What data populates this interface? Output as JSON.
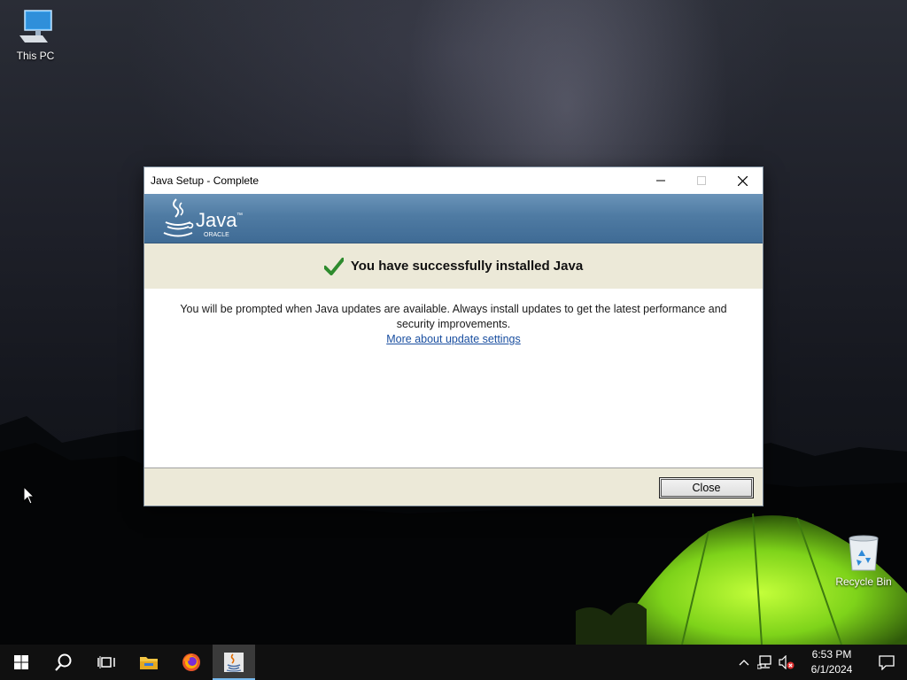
{
  "desktop": {
    "icons": [
      {
        "label": "This PC",
        "icon": "this-pc-icon"
      },
      {
        "label": "Recycle Bin",
        "icon": "recycle-bin-icon"
      }
    ]
  },
  "dialog": {
    "title": "Java Setup - Complete",
    "brand": {
      "name": "Java",
      "trademark": "™",
      "vendor": "ORACLE"
    },
    "headline": "You have successfully installed Java",
    "message": "You will be prompted when Java updates are available. Always install updates to get the latest performance and security improvements.",
    "link": "More about update settings",
    "close_button": "Close",
    "colors": {
      "banner": "#4f7ba3",
      "panel": "#ece9d8",
      "check": "#2e8b2e",
      "link": "#1a4fa0"
    }
  },
  "taskbar": {
    "items": [
      {
        "name": "start",
        "icon": "windows-logo-icon"
      },
      {
        "name": "search",
        "icon": "search-icon"
      },
      {
        "name": "task-view",
        "icon": "task-view-icon"
      },
      {
        "name": "file-explorer",
        "icon": "folder-icon"
      },
      {
        "name": "firefox",
        "icon": "firefox-icon"
      },
      {
        "name": "java-setup",
        "icon": "java-icon",
        "active": true
      }
    ],
    "tray": {
      "time": "6:53 PM",
      "date": "6/1/2024",
      "icons": [
        "chevron-up-icon",
        "network-icon",
        "volume-muted-icon",
        "notification-icon"
      ]
    }
  }
}
